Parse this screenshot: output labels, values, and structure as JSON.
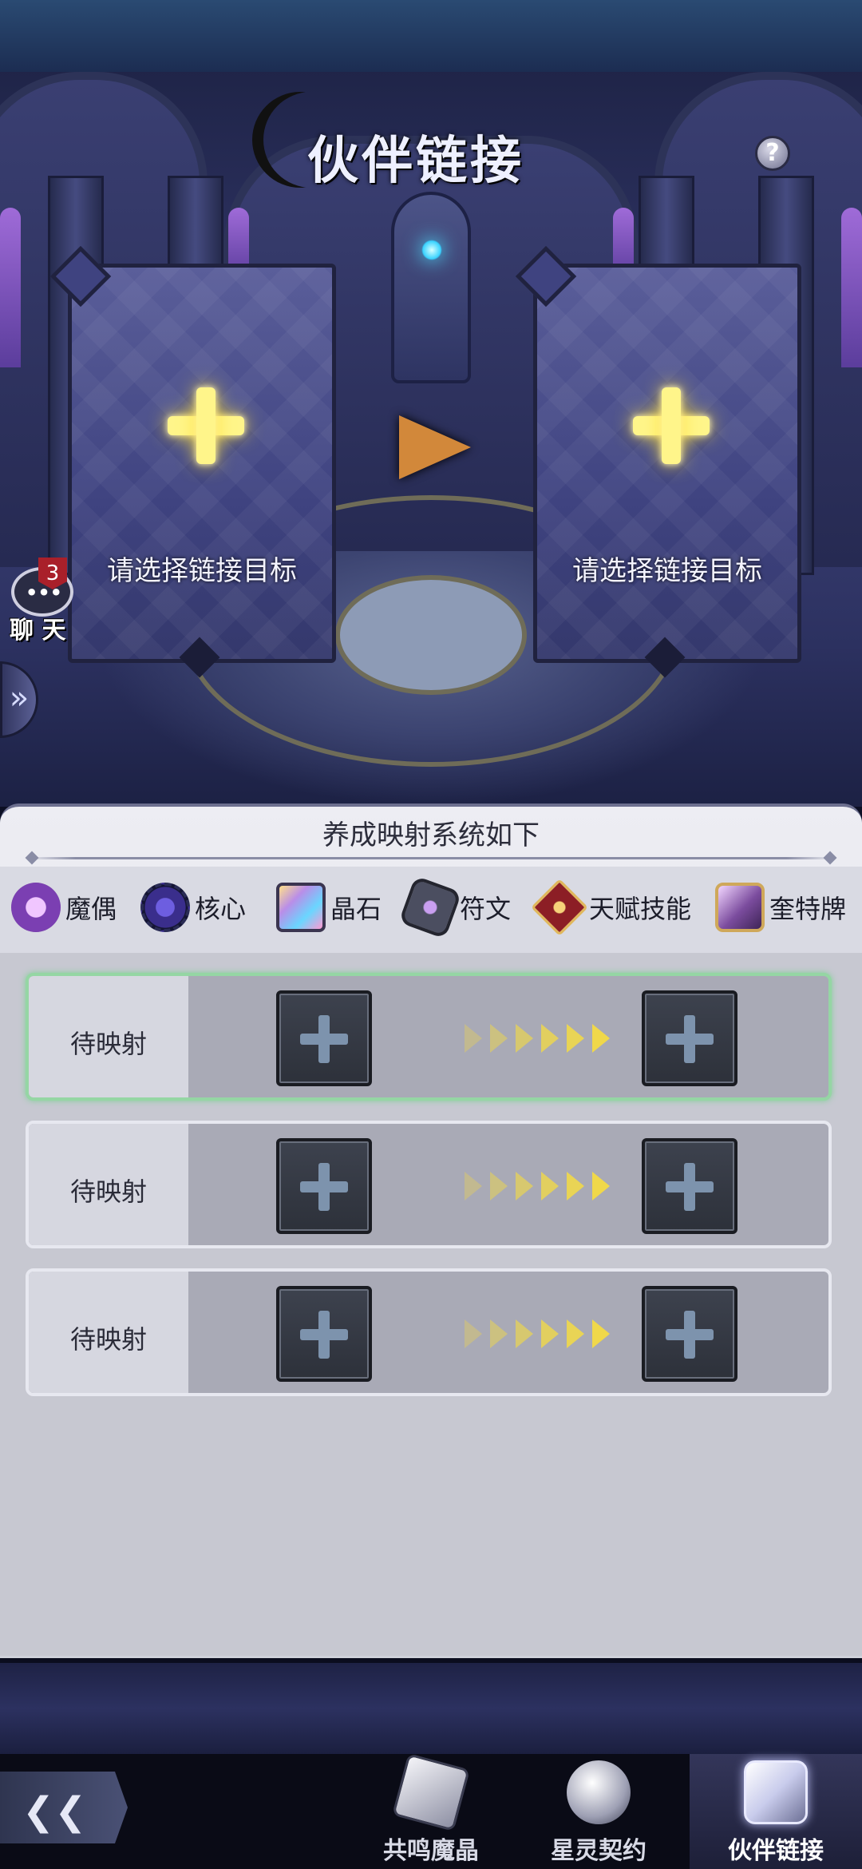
{
  "screen_title": "伙伴链接",
  "help_label": "?",
  "cards": [
    {
      "label": "请选择链接目标"
    },
    {
      "label": "请选择链接目标"
    }
  ],
  "chat": {
    "label": "聊 天",
    "badge": "3"
  },
  "panel": {
    "title": "养成映射系统如下",
    "systems": [
      {
        "label": "魔偶",
        "icon": "puppet-icon",
        "color": "#7b3fb2"
      },
      {
        "label": "核心",
        "icon": "core-icon",
        "color": "#3a2e8c"
      },
      {
        "label": "晶石",
        "icon": "crystal-icon",
        "color": "#b98ee8"
      },
      {
        "label": "符文",
        "icon": "rune-icon",
        "color": "#4b4e60"
      },
      {
        "label": "天赋技能",
        "icon": "talent-icon",
        "color": "#8c1e25"
      },
      {
        "label": "奎特牌",
        "icon": "quest-card-icon",
        "color": "#7b4c9e"
      }
    ],
    "rows": [
      {
        "label": "待映射",
        "selected": true
      },
      {
        "label": "待映射",
        "selected": false
      },
      {
        "label": "待映射",
        "selected": false
      }
    ]
  },
  "nav": {
    "back_icon": "back-arrow-icon",
    "tabs": [
      {
        "label": "共鸣魔晶",
        "active": false
      },
      {
        "label": "星灵契约",
        "active": false
      },
      {
        "label": "伙伴链接",
        "active": true
      }
    ]
  },
  "colors": {
    "accent_gold": "#f0d84a",
    "selected_row": "#95d6a4",
    "badge_red": "#a9202a"
  }
}
